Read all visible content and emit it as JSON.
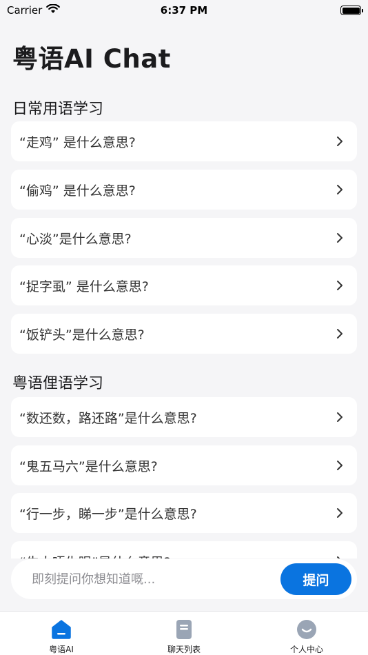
{
  "status_bar": {
    "carrier": "Carrier",
    "time": "6:37 PM",
    "battery_level": 1.0
  },
  "header": {
    "title": "粤语AI Chat"
  },
  "sections": [
    {
      "title": "日常用语学习",
      "items": [
        {
          "label": "“走鸡” 是什么意思?"
        },
        {
          "label": "“偷鸡” 是什么意思?"
        },
        {
          "label": "“心淡”是什么意思?"
        },
        {
          "label": "“捉字虱” 是什么意思?"
        },
        {
          "label": "“饭铲头”是什么意思?"
        }
      ]
    },
    {
      "title": "粤语俚语学习",
      "items": [
        {
          "label": "“数还数，路还路”是什么意思?"
        },
        {
          "label": "“鬼五马六”是什么意思?"
        },
        {
          "label": "“行一步，睇一步”是什么意思?"
        },
        {
          "label": "“牛大唔生眼”是什么意思?"
        }
      ]
    }
  ],
  "ask": {
    "placeholder": "即刻提问你想知道嘅...",
    "value": "",
    "button_label": "提问"
  },
  "tab_bar": {
    "tabs": [
      {
        "label": "粤语AI",
        "icon": "home-icon",
        "active": true
      },
      {
        "label": "聊天列表",
        "icon": "chat-list-icon",
        "active": false
      },
      {
        "label": "个人中心",
        "icon": "profile-icon",
        "active": false
      }
    ]
  },
  "colors": {
    "accent": "#0a74e0",
    "background": "#f5f5f7",
    "card": "#ffffff",
    "icon_inactive": "#9aa5b5"
  }
}
